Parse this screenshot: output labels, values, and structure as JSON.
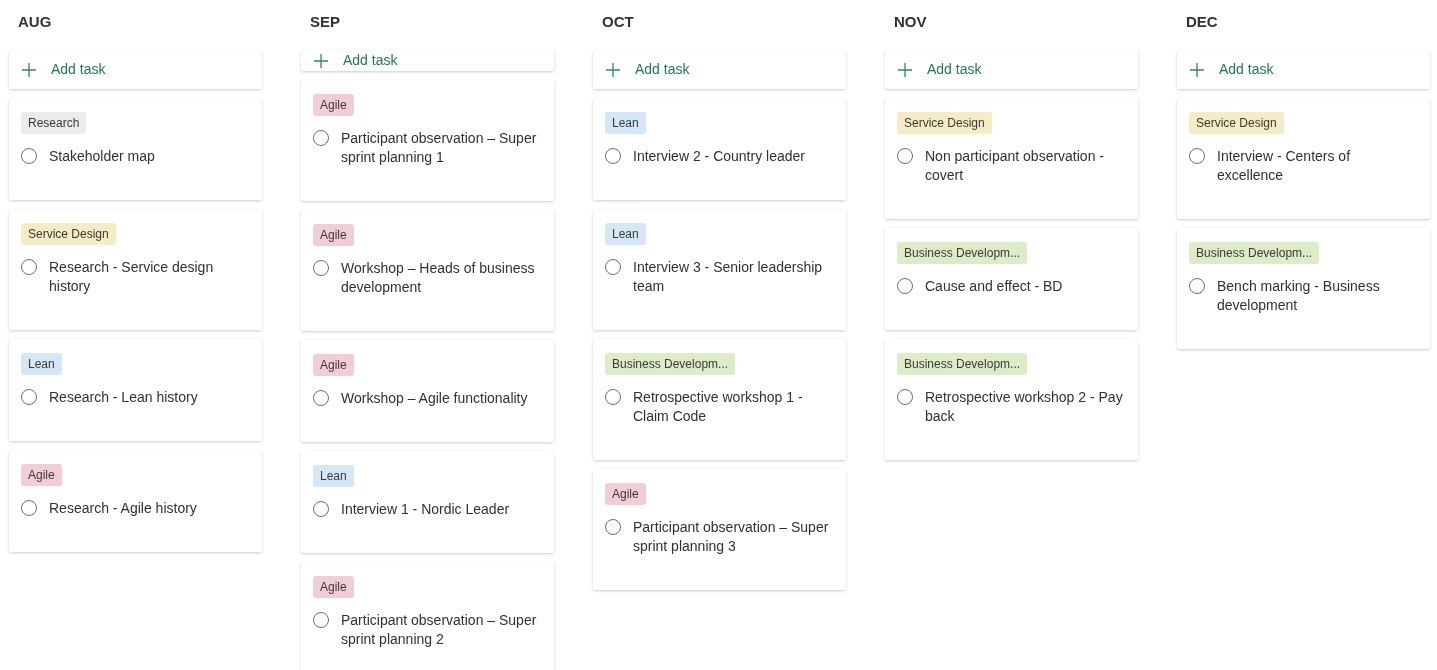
{
  "columns": [
    {
      "title": "AUG",
      "add_label": "Add task",
      "cards": [
        {
          "label": {
            "text": "Research",
            "color": "#e9ebed"
          },
          "task": "Stakeholder map",
          "completed": false
        },
        {
          "label": {
            "text": "Service Design",
            "color": "#f5ecc6"
          },
          "task": "Research - Service design history",
          "completed": false
        },
        {
          "label": {
            "text": "Lean",
            "color": "#d4e7f6"
          },
          "task": "Research - Lean history",
          "completed": false
        },
        {
          "label": {
            "text": "Agile",
            "color": "#f2cdd4"
          },
          "task": "Research - Agile history",
          "completed": false
        }
      ]
    },
    {
      "title": "SEP",
      "add_label": "Add task",
      "cards": [
        {
          "label": {
            "text": "Agile",
            "color": "#f2cdd4"
          },
          "task": "Participant observation – Super sprint planning 1",
          "completed": false
        },
        {
          "label": {
            "text": "Agile",
            "color": "#f2cdd4"
          },
          "task": "Workshop – Heads of business development",
          "completed": false
        },
        {
          "label": {
            "text": "Agile",
            "color": "#f2cdd4"
          },
          "task": "Workshop – Agile functionality",
          "completed": false
        },
        {
          "label": {
            "text": "Lean",
            "color": "#d4e7f6"
          },
          "task": "Interview 1 - Nordic Leader",
          "completed": false
        },
        {
          "label": {
            "text": "Agile",
            "color": "#f2cdd4"
          },
          "task": "Participant observation – Super sprint planning 2",
          "completed": false
        }
      ]
    },
    {
      "title": "OCT",
      "add_label": "Add task",
      "cards": [
        {
          "label": {
            "text": "Lean",
            "color": "#d4e7f6"
          },
          "task": "Interview 2 - Country leader",
          "completed": false
        },
        {
          "label": {
            "text": "Lean",
            "color": "#d4e7f6"
          },
          "task": "Interview 3 - Senior leadership team",
          "completed": false
        },
        {
          "label": {
            "text": "Business Developm...",
            "color": "#dbecc6"
          },
          "task": "Retrospective workshop 1 - Claim Code",
          "completed": false
        },
        {
          "label": {
            "text": "Agile",
            "color": "#f2cdd4"
          },
          "task": "Participant observation – Super sprint planning 3",
          "completed": false
        }
      ]
    },
    {
      "title": "NOV",
      "add_label": "Add task",
      "cards": [
        {
          "label": {
            "text": "Service Design",
            "color": "#f5ecc6"
          },
          "task": "Non participant observation - covert",
          "completed": false
        },
        {
          "label": {
            "text": "Business Developm...",
            "color": "#dbecc6"
          },
          "task": "Cause and effect - BD",
          "completed": false
        },
        {
          "label": {
            "text": "Business Developm...",
            "color": "#dbecc6"
          },
          "task": "Retrospective workshop 2 - Pay back",
          "completed": false
        }
      ]
    },
    {
      "title": "DEC",
      "add_label": "Add task",
      "cards": [
        {
          "label": {
            "text": "Service Design",
            "color": "#f5ecc6"
          },
          "task": "Interview - Centers of excellence",
          "completed": false
        },
        {
          "label": {
            "text": "Business Developm...",
            "color": "#dbecc6"
          },
          "task": "Bench marking - Business development",
          "completed": false
        }
      ]
    }
  ]
}
